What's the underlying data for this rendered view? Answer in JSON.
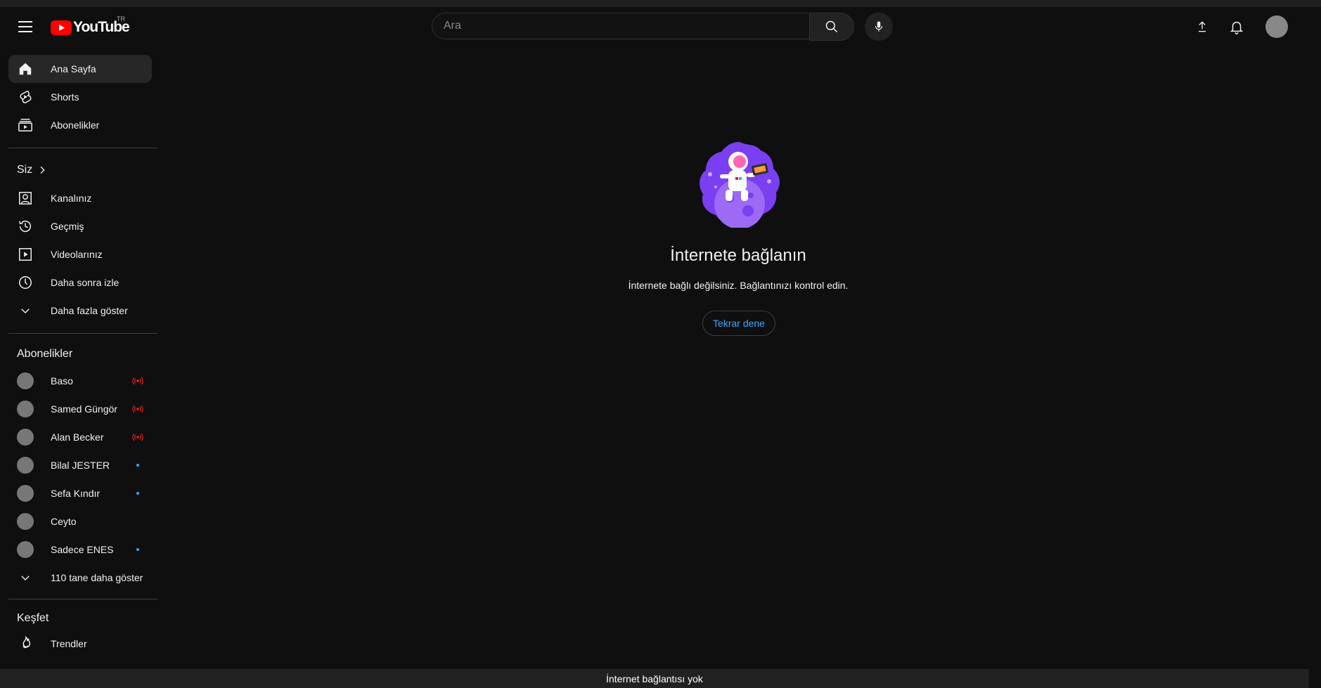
{
  "header": {
    "logo_text": "YouTube",
    "country_code": "TR",
    "search_placeholder": "Ara"
  },
  "sidebar": {
    "main": [
      {
        "label": "Ana Sayfa",
        "icon": "home-icon"
      },
      {
        "label": "Shorts",
        "icon": "shorts-icon"
      },
      {
        "label": "Abonelikler",
        "icon": "subscriptions-icon"
      }
    ],
    "you_title": "Siz",
    "you": [
      {
        "label": "Kanalınız",
        "icon": "your-channel-icon"
      },
      {
        "label": "Geçmiş",
        "icon": "history-icon"
      },
      {
        "label": "Videolarınız",
        "icon": "your-videos-icon"
      },
      {
        "label": "Daha sonra izle",
        "icon": "watch-later-icon"
      },
      {
        "label": "Daha fazla göster",
        "icon": "chevron-down-icon"
      }
    ],
    "subscriptions_title": "Abonelikler",
    "subscriptions": [
      {
        "name": "Baso",
        "status": "live"
      },
      {
        "name": "Samed Güngör",
        "status": "live"
      },
      {
        "name": "Alan Becker",
        "status": "live"
      },
      {
        "name": "Bilal JESTER",
        "status": "new"
      },
      {
        "name": "Sefa Kındır",
        "status": "new"
      },
      {
        "name": "Ceyto",
        "status": ""
      },
      {
        "name": "Sadece ENES",
        "status": "new"
      }
    ],
    "show_more_subs": "110 tane daha göster",
    "explore_title": "Keşfet",
    "explore": [
      {
        "label": "Trendler",
        "icon": "trending-icon"
      }
    ]
  },
  "main": {
    "title": "İnternete bağlanın",
    "message": "İnternete bağlı değilsiniz. Bağlantınızı kontrol edin.",
    "retry_label": "Tekrar dene"
  },
  "status_bar": {
    "text": "İnternet bağlantısı yok"
  },
  "colors": {
    "background": "#0f0f0f",
    "accent_red": "#ff0000",
    "link_blue": "#3ea6ff",
    "live_red": "#e91e1e",
    "illustration_purple": "#7a3ff0"
  }
}
